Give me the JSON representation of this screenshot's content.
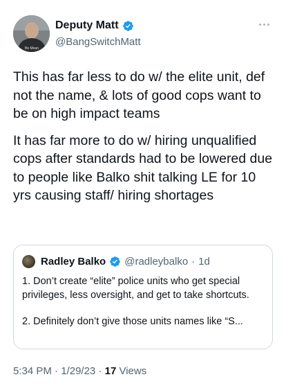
{
  "author": {
    "display_name": "Deputy Matt",
    "handle": "@BangSwitchMatt",
    "avatar_caption": "Be Mean"
  },
  "colors": {
    "verified": "#1d9bf0",
    "text": "#0f1419",
    "secondary": "#536471",
    "border": "#cfd9de"
  },
  "tweet": {
    "paragraphs": [
      "This has far less to do w/ the  elite unit, def not the name, & lots of good cops want to be on high impact teams",
      "It has far more to do w/ hiring unqualified cops after standards had to be lowered due to people like Balko shit talking LE for 10 yrs causing staff/ hiring shortages"
    ]
  },
  "quoted_tweet": {
    "display_name": "Radley Balko",
    "handle": "@radleybalko",
    "separator": "·",
    "time": "1d",
    "paragraphs": [
      "1. Don’t create “elite” police units who get special privileges, less oversight, and get to take shortcuts.",
      "2. Definitely don’t give those units names like “S..."
    ]
  },
  "meta": {
    "time": "5:34 PM",
    "sep1": "·",
    "date": "1/29/23",
    "sep2": "·",
    "views_count": "17",
    "views_label": "Views"
  }
}
